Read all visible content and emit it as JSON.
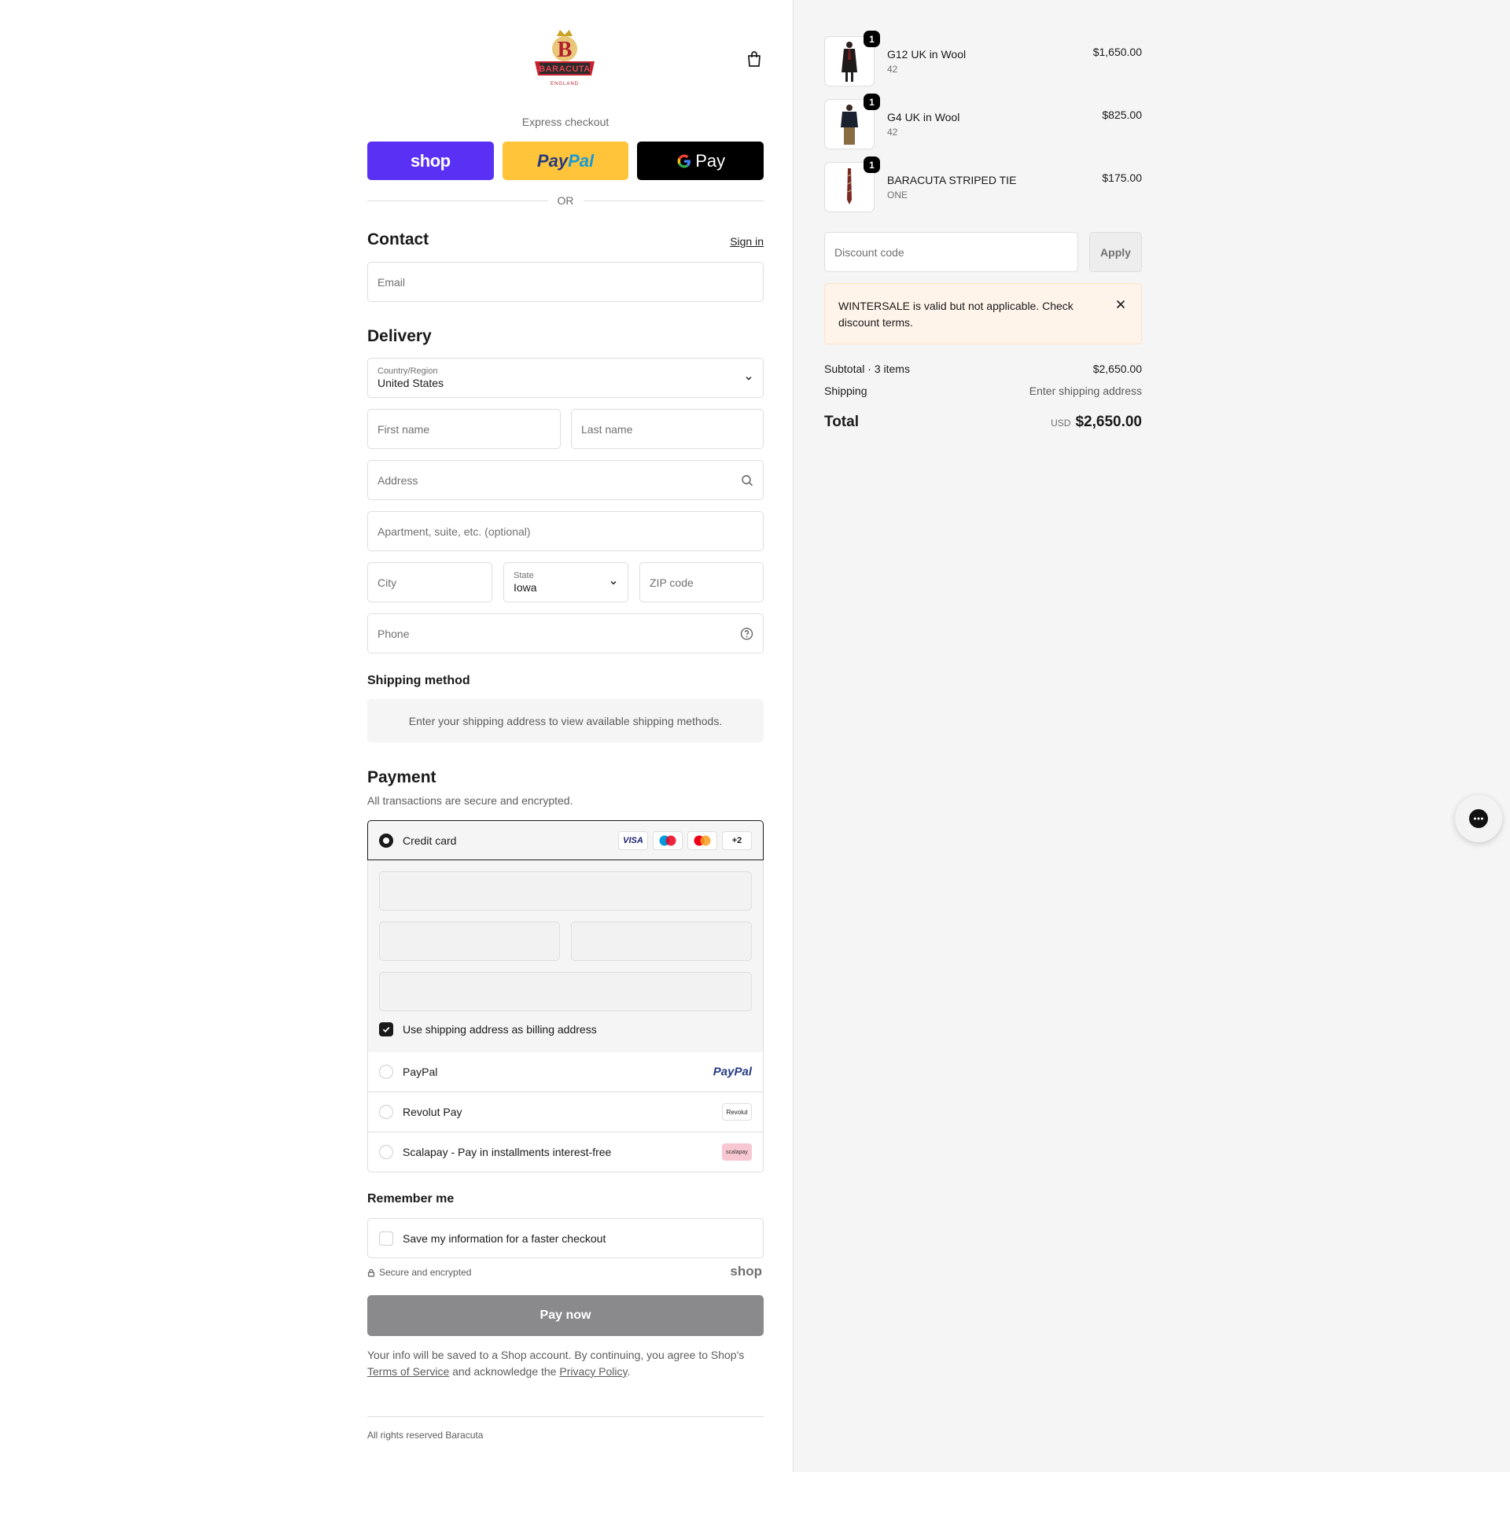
{
  "brand": {
    "name": "BARACUTA",
    "subtitle": "ENGLAND"
  },
  "express": {
    "label": "Express checkout",
    "shop_label": "shop",
    "paypal_label_1": "Pay",
    "paypal_label_2": "Pal",
    "gpay_label": "Pay",
    "or_label": "OR"
  },
  "contact": {
    "title": "Contact",
    "sign_in": "Sign in",
    "email_placeholder": "Email"
  },
  "delivery": {
    "title": "Delivery",
    "country_label": "Country/Region",
    "country_value": "United States",
    "first_name_placeholder": "First name",
    "last_name_placeholder": "Last name",
    "address_placeholder": "Address",
    "apartment_placeholder": "Apartment, suite, etc. (optional)",
    "city_placeholder": "City",
    "state_label": "State",
    "state_value": "Iowa",
    "zip_placeholder": "ZIP code",
    "phone_placeholder": "Phone"
  },
  "shipping_method": {
    "title": "Shipping method",
    "message": "Enter your shipping address to view available shipping methods."
  },
  "payment": {
    "title": "Payment",
    "subtitle": "All transactions are secure and encrypted.",
    "credit_card_label": "Credit card",
    "card_badges": [
      "VISA",
      "",
      "",
      "+2"
    ],
    "billing_same_label": "Use shipping address as billing address",
    "billing_same_checked": true,
    "paypal_label": "PayPal",
    "paypal_logo": "PayPal",
    "revolut_label": "Revolut Pay",
    "revolut_logo": "Revolut",
    "scalapay_label": "Scalapay - Pay in installments interest-free",
    "scalapay_logo": "scalapay"
  },
  "remember": {
    "title": "Remember me",
    "save_label": "Save my information for a faster checkout",
    "secure_label": "Secure and encrypted",
    "shop_mark": "shop"
  },
  "pay_now_label": "Pay now",
  "legal": {
    "text_1": "Your info will be saved to a Shop account. By continuing, you agree to Shop's",
    "terms": "Terms of Service",
    "text_2": "and acknowledge the",
    "privacy": "Privacy Policy",
    "text_3": "."
  },
  "footer": "All rights reserved Baracuta",
  "cart": {
    "items": [
      {
        "name": "G12 UK in Wool",
        "variant": "42",
        "price": "$1,650.00",
        "qty": "1"
      },
      {
        "name": "G4 UK in Wool",
        "variant": "42",
        "price": "$825.00",
        "qty": "1"
      },
      {
        "name": "BARACUTA STRIPED TIE",
        "variant": "ONE",
        "price": "$175.00",
        "qty": "1"
      }
    ],
    "discount_placeholder": "Discount code",
    "apply_label": "Apply",
    "warning": "WINTERSALE is valid but not applicable. Check discount terms.",
    "subtotal_label": "Subtotal · 3 items",
    "subtotal_value": "$2,650.00",
    "shipping_label": "Shipping",
    "shipping_value": "Enter shipping address",
    "total_label": "Total",
    "total_currency": "USD",
    "total_value": "$2,650.00"
  },
  "colors": {
    "shop_purple": "#5a31f4",
    "paypal_yellow": "#ffc439",
    "pay_now_disabled": "#8a8a8c",
    "warning_bg": "#fff4ea"
  }
}
